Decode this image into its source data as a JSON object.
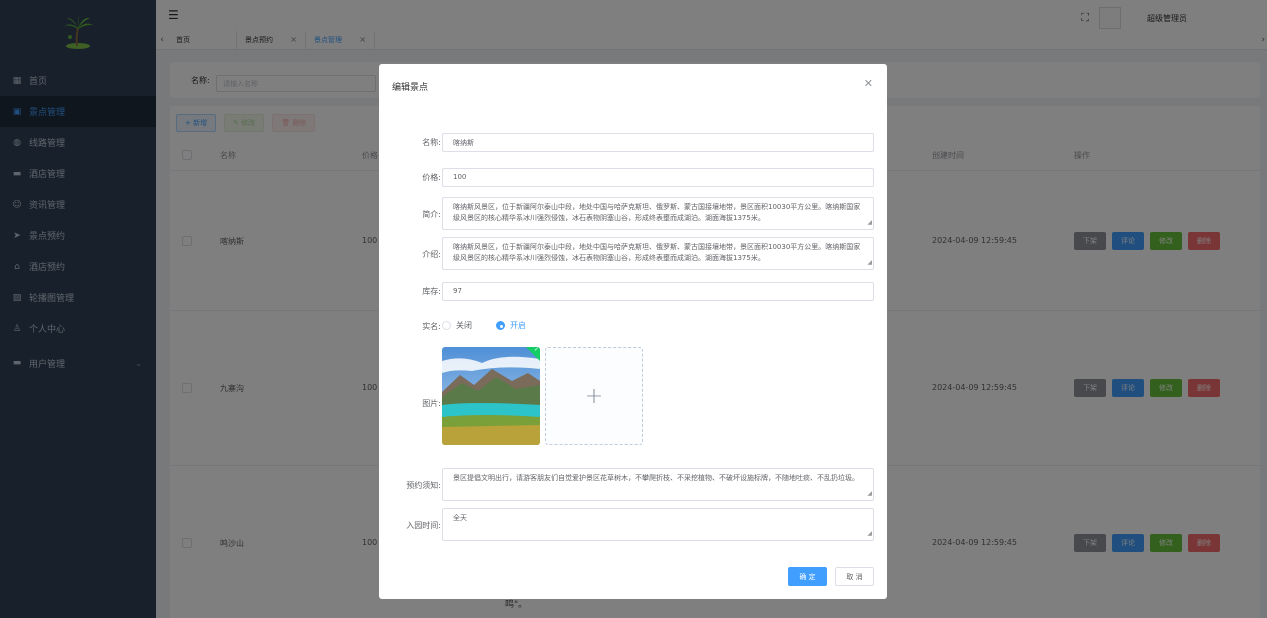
{
  "sidebar": {
    "items": [
      {
        "label": "首页",
        "icon": "dashboard-icon"
      },
      {
        "label": "景点管理",
        "icon": "scenic-icon"
      },
      {
        "label": "线路管理",
        "icon": "route-icon"
      },
      {
        "label": "酒店管理",
        "icon": "hotel-icon"
      },
      {
        "label": "资讯管理",
        "icon": "news-icon"
      },
      {
        "label": "景点预约",
        "icon": "send-icon"
      },
      {
        "label": "酒店预约",
        "icon": "home-icon"
      },
      {
        "label": "轮播图管理",
        "icon": "image-icon"
      },
      {
        "label": "个人中心",
        "icon": "user-icon"
      },
      {
        "label": "用户管理",
        "icon": "users-icon"
      }
    ]
  },
  "header": {
    "admin_name": "超级管理员"
  },
  "tags": [
    {
      "label": "首页"
    },
    {
      "label": "景点预约"
    },
    {
      "label": "景点管理"
    }
  ],
  "search": {
    "label": "名称:",
    "placeholder": "请输入名称"
  },
  "toolbar": {
    "add_label": "+ 新增",
    "edit_label": "✎ 修改",
    "delete_label": "🗑 删除"
  },
  "table": {
    "headers": {
      "name": "名称",
      "price": "价格",
      "created": "创建时间",
      "ops": "操作"
    },
    "rows": [
      {
        "name": "喀纳斯",
        "price": "100",
        "created": "2024-04-09 12:59:45"
      },
      {
        "name": "九寨沟",
        "price": "100",
        "created": "2024-04-09 12:59:45"
      },
      {
        "name": "鸣沙山",
        "price": "100",
        "created": "2024-04-09 12:59:45"
      }
    ],
    "op_labels": {
      "off": "下架",
      "review": "评论",
      "modify": "修改",
      "remove": "删除"
    },
    "stray_text": "鸣\"。"
  },
  "dialog": {
    "title": "编辑景点",
    "fields": {
      "name_label": "名称:",
      "name_value": "喀纳斯",
      "price_label": "价格:",
      "price_value": "100",
      "brief_label": "简介:",
      "brief_value": "喀纳斯风景区，位于新疆阿尔泰山中段，地处中国与哈萨克斯坦、俄罗斯、蒙古国接壤地带，景区面积10030平方公里。喀纳斯国家级风景区的核心精华系冰川强烈侵蚀，冰石表物阴塞山谷，形成终表壅而成湖泊。湖面海拔1375米。",
      "intro_label": "介绍:",
      "intro_value": "喀纳斯风景区，位于新疆阿尔泰山中段，地处中国与哈萨克斯坦、俄罗斯、蒙古国接壤地带，景区面积10030平方公里。喀纳斯国家级风景区的核心精华系冰川强烈侵蚀，冰石表物阴塞山谷，形成终表壅而成湖泊。湖面海拔1375米。",
      "stock_label": "库存:",
      "stock_value": "97",
      "realname_label": "实名:",
      "realname_off": "关闭",
      "realname_on": "开启",
      "image_label": "图片:",
      "notice_label": "预约须知:",
      "notice_value": "景区提倡文明出行，请游客朋友们自觉爱护景区花草树木，不攀爬折枝、不采挖植物、不破坏设施标牌，不随地吐痰、不乱扔垃圾。",
      "entry_label": "入园时间:",
      "entry_value": "全天"
    },
    "confirm_label": "确 定",
    "cancel_label": "取 消"
  },
  "colors": {
    "sidebar_bg": "#304156",
    "primary": "#409eff",
    "success": "#67c23a",
    "danger": "#f56c6c"
  }
}
